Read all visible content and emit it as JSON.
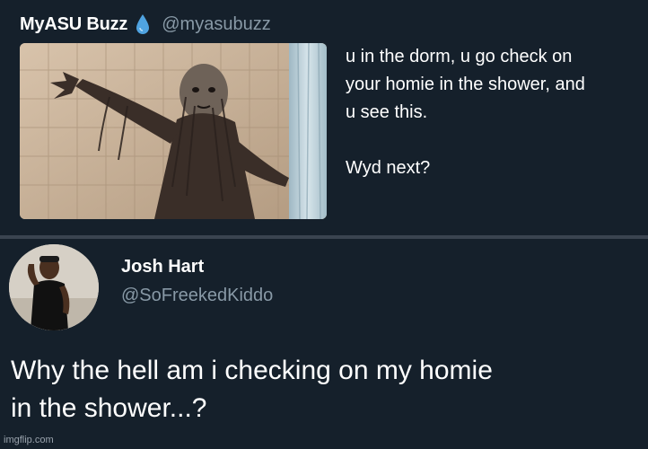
{
  "tweet1": {
    "name": "MyASU Buzz",
    "handle": "@myasubuzz",
    "text": "u in the dorm, u go check on\nyour homie in the shower, and\nu see this.\n\nWyd next?",
    "verified_icon": "water-drop-icon",
    "image": "creepy-figure-in-shower-photo"
  },
  "tweet2": {
    "name": "Josh Hart",
    "handle": "@SoFreekedKiddo",
    "text": "Why the hell am i checking on my homie\nin the shower...?",
    "avatar": "avatar-photo"
  },
  "watermark": "imgflip.com",
  "colors": {
    "background": "#15202b",
    "text_primary": "#ffffff",
    "text_secondary": "#8899a6",
    "divider": "#3a4450",
    "drop_icon": "#4fa3e0"
  }
}
